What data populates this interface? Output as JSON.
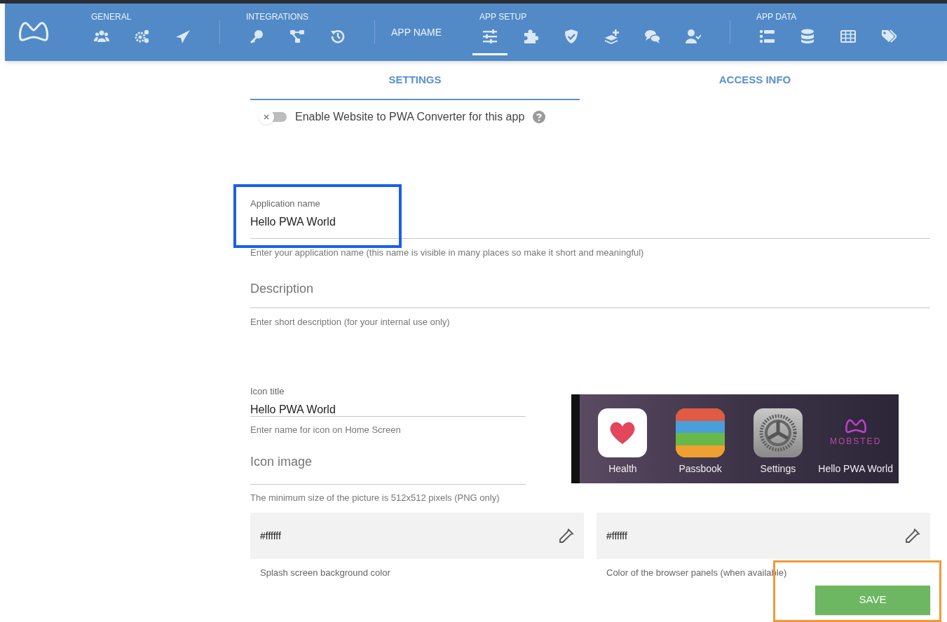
{
  "nav": {
    "groups": [
      {
        "label": "GENERAL",
        "items": [
          {
            "selected": false
          },
          {
            "selected": false
          },
          {
            "selected": false
          }
        ]
      },
      {
        "label": "INTEGRATIONS",
        "items": [
          {
            "selected": false
          },
          {
            "selected": false
          },
          {
            "selected": false
          }
        ]
      },
      {
        "label": "APP SETUP",
        "app_name": "APP NAME",
        "items": [
          {
            "selected": true
          },
          {
            "selected": false
          },
          {
            "selected": false
          },
          {
            "selected": false
          },
          {
            "selected": false
          },
          {
            "selected": false
          }
        ]
      },
      {
        "label": "APP DATA",
        "items": [
          {
            "selected": false
          },
          {
            "selected": false
          },
          {
            "selected": false
          },
          {
            "selected": false
          }
        ]
      }
    ]
  },
  "tabs": [
    {
      "label": "SETTINGS",
      "selected": true
    },
    {
      "label": "ACCESS INFO",
      "selected": false
    }
  ],
  "pwa_toggle": {
    "label": "Enable Website to PWA Converter for this app",
    "on": false
  },
  "fields": {
    "application_name": {
      "label": "Application name",
      "value": "Hello PWA World",
      "hint": "Enter your application name (this name is visible in many places so make it short and meaningful)"
    },
    "description": {
      "placeholder": "Description",
      "hint": "Enter short description (for your internal use only)"
    },
    "icon_title": {
      "label": "Icon title",
      "value": "Hello PWA World",
      "hint": "Enter name for icon on Home Screen"
    },
    "icon_image": {
      "placeholder": "Icon image",
      "hint": "The minimum size of the picture is 512x512 pixels (PNG only)"
    }
  },
  "preview": {
    "apps": [
      {
        "kind": "heart",
        "label": "Health"
      },
      {
        "kind": "passbook",
        "label": "Passbook"
      },
      {
        "kind": "settings",
        "label": "Settings"
      },
      {
        "kind": "logo",
        "logo_text": "MOBSTED",
        "label": "Hello PWA World"
      }
    ]
  },
  "colors": [
    {
      "value": "#ffffff",
      "hint": "Splash screen background color"
    },
    {
      "value": "#ffffff",
      "hint": "Color of the browser panels (when available)"
    }
  ],
  "save_button": "SAVE",
  "annotations": [
    {
      "kind": "frame",
      "color": "#1a5ef0"
    },
    {
      "kind": "frame",
      "color": "#f09a3a"
    }
  ]
}
